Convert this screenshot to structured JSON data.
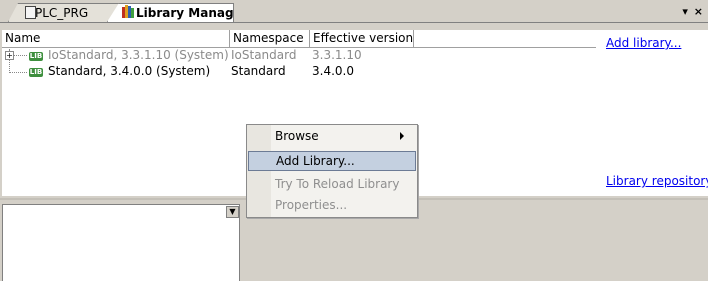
{
  "tabs": [
    {
      "label": "PLC_PRG",
      "icon": "document-icon"
    },
    {
      "label": "Library Manager",
      "icon": "library-books-icon"
    }
  ],
  "pane_controls": "▾ ×",
  "table": {
    "headers": [
      "Name",
      "Namespace",
      "Effective version"
    ],
    "rows": [
      {
        "name": "IoStandard, 3.3.1.10 (System)",
        "namespace": "IoStandard",
        "version": "3.3.1.10",
        "greyed": true
      },
      {
        "name": "Standard, 3.4.0.0 (System)",
        "namespace": "Standard",
        "version": "3.4.0.0",
        "greyed": false
      }
    ]
  },
  "library_icon_text": "LIB",
  "links": {
    "add_library": "Add library...",
    "library_repository": "Library repository..."
  },
  "context_menu": {
    "items": [
      {
        "label": "Browse",
        "has_submenu": true,
        "enabled": true
      },
      {
        "label": "Add Library...",
        "highlighted": true,
        "enabled": true
      },
      {
        "label": "Try To Reload Library",
        "enabled": false
      },
      {
        "label": "Properties...",
        "enabled": false
      }
    ]
  },
  "colors": {
    "link": "#0000ee",
    "highlight": "#c4d0e0",
    "disabled_text": "#8f8f8f"
  }
}
